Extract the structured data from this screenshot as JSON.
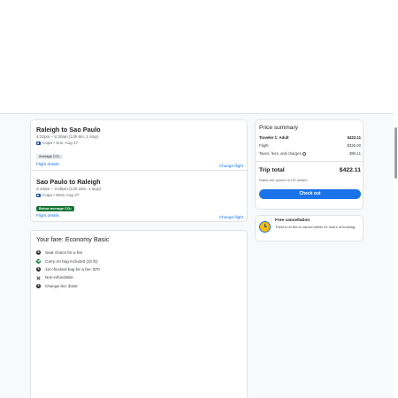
{
  "itinerary": {
    "legs": [
      {
        "title": "Raleigh to Sao Paulo",
        "times": "4:22pm – 6:30am (13h 8m, 1 stop)",
        "airline": "Copa • Sun, Aug 17",
        "co2": "Average CO₂",
        "details_link": "Flight details",
        "change_link": "Change flight"
      },
      {
        "title": "Sao Paulo to Raleigh",
        "times": "3:10am – 3:28pm (12h 18m, 1 stop)",
        "airline": "Copa • Wed, Aug 27",
        "co2": "Below average CO₂",
        "details_link": "Flight details",
        "change_link": "Change flight"
      }
    ]
  },
  "fare": {
    "title": "Your fare: Economy Basic",
    "items": [
      {
        "icon": "dollar-icon",
        "text": "Seat choice for a fee"
      },
      {
        "icon": "check-icon",
        "text": "Carry-on bag included (22 lb)"
      },
      {
        "icon": "dollar-icon",
        "text": "1st checked bag for a fee: $70"
      },
      {
        "icon": "x-icon",
        "text": "Non-refundable"
      },
      {
        "icon": "dollar-icon",
        "text": "Change fee: $150"
      }
    ]
  },
  "price": {
    "title": "Price summary",
    "traveler_label": "Traveler 1: Adult",
    "traveler_value": "$422.11",
    "flight_label": "Flight",
    "flight_value": "$336.00",
    "taxes_label": "Taxes, fees, and charges",
    "taxes_value": "$86.11",
    "total_label": "Trip total",
    "total_value": "$422.11",
    "rates_note": "Rates are quoted in US dollars",
    "checkout_label": "Check out"
  },
  "cancellation": {
    "title": "Free cancellation",
    "description": "There's no fee to cancel within 24 hours of booking."
  },
  "colors": {
    "accent": "#1a73e8",
    "below_average_badge": "#137333",
    "included_check": "#188038"
  }
}
